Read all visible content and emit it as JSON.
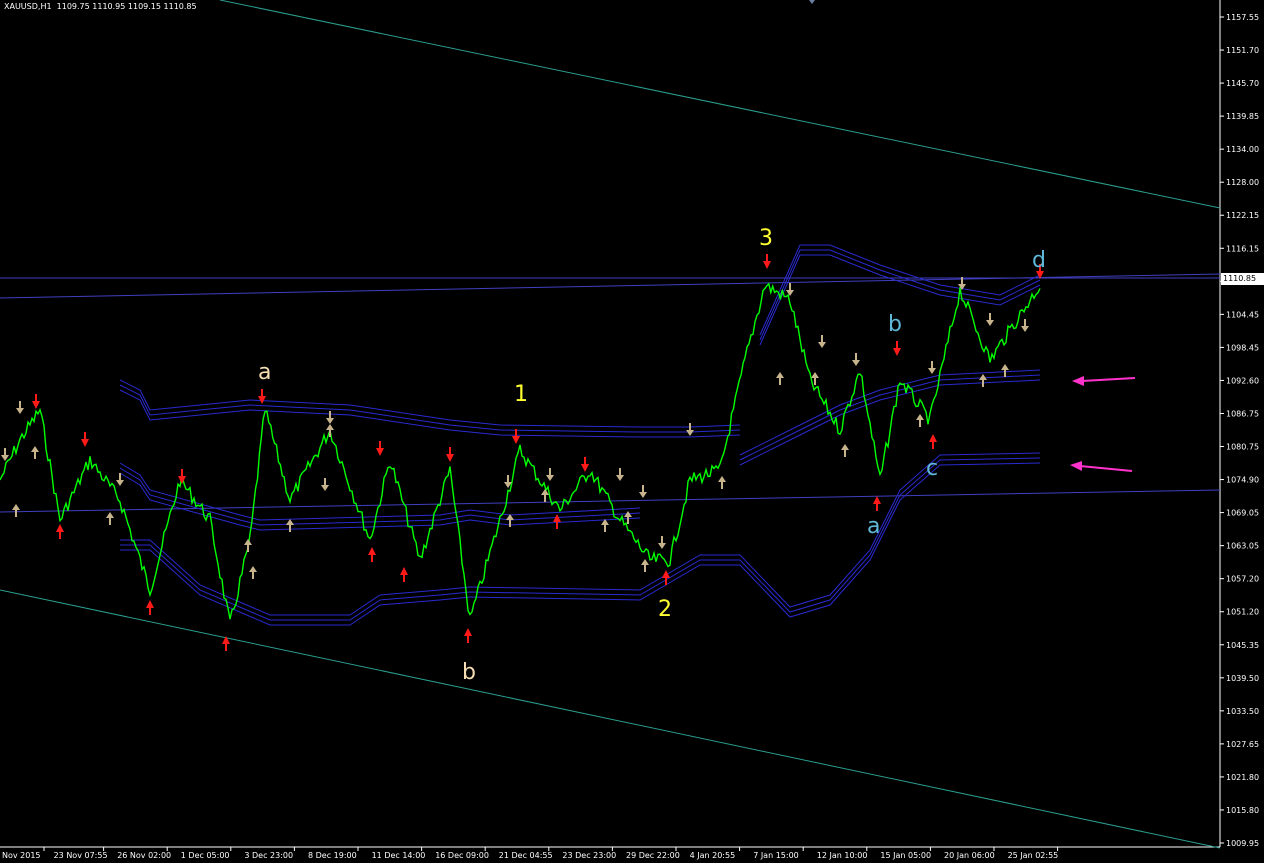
{
  "header": {
    "symbol_text": "XAUUSD,H1  1109.75 1110.95 1109.15 1110.85"
  },
  "price_axis": {
    "ticks": [
      "1157.55",
      "1151.70",
      "1145.70",
      "1139.85",
      "1134.00",
      "1128.00",
      "1122.15",
      "1116.15",
      "1110.85",
      "1104.45",
      "1098.45",
      "1092.60",
      "1086.75",
      "1080.75",
      "1074.90",
      "1069.05",
      "1063.05",
      "1057.20",
      "1051.20",
      "1045.35",
      "1039.50",
      "1033.50",
      "1027.65",
      "1021.80",
      "1015.80",
      "1009.95"
    ],
    "current_price": "1110.85"
  },
  "time_axis": {
    "ticks": [
      "Nov 2015",
      "23 Nov 07:55",
      "26 Nov 02:00",
      "1 Dec 05:00",
      "3 Dec 23:00",
      "8 Dec 19:00",
      "11 Dec 14:00",
      "16 Dec 09:00",
      "21 Dec 04:55",
      "23 Dec 23:00",
      "29 Dec 22:00",
      "4 Jan 20:55",
      "7 Jan 15:00",
      "12 Jan 10:00",
      "15 Jan 05:00",
      "20 Jan 06:00",
      "25 Jan 02:55"
    ]
  },
  "wave_labels": [
    {
      "text": "a",
      "color": "#f5deb3"
    },
    {
      "text": "b",
      "color": "#f5deb3"
    },
    {
      "text": "1",
      "color": "#ffff33"
    },
    {
      "text": "2",
      "color": "#ffff33"
    },
    {
      "text": "3",
      "color": "#ffff33"
    },
    {
      "text": "a",
      "color": "#5fb8d8"
    },
    {
      "text": "b",
      "color": "#5fb8d8"
    },
    {
      "text": "c",
      "color": "#5fb8d8"
    },
    {
      "text": "d",
      "color": "#5fb8d8"
    }
  ],
  "colors": {
    "background": "#000000",
    "price_line": "#00ff00",
    "channel": "#2a9d8f",
    "bands": "#2a2ad0",
    "trendline": "#4040c0",
    "fractal_up": "#ff1a1a",
    "fractal_dn": "#c8b48c",
    "annotation_arrow": "#ff33cc"
  },
  "chart_data": {
    "type": "line",
    "title": "XAUUSD,H1",
    "series": [
      {
        "name": "XAUUSD,H1",
        "x": [
          "Nov 2015",
          "23 Nov 07:55",
          "26 Nov 02:00",
          "1 Dec 05:00",
          "3 Dec 23:00",
          "8 Dec 19:00",
          "11 Dec 14:00",
          "16 Dec 09:00",
          "21 Dec 04:55",
          "23 Dec 23:00",
          "29 Dec 22:00",
          "4 Jan 20:55",
          "7 Jan 15:00",
          "12 Jan 10:00",
          "15 Jan 05:00",
          "20 Jan 06:00",
          "25 Jan 02:55"
        ],
        "values": [
          1066,
          1070,
          1073,
          1047,
          1088,
          1074,
          1078,
          1048,
          1080,
          1069,
          1062,
          1080,
          1108,
          1085,
          1076,
          1102,
          1110.85
        ]
      }
    ],
    "ylim": [
      1009.95,
      1157.55
    ],
    "grid": false,
    "legend": "none"
  },
  "annotations": {
    "arrows": [
      "pink-arrow-upper",
      "pink-arrow-lower"
    ]
  }
}
